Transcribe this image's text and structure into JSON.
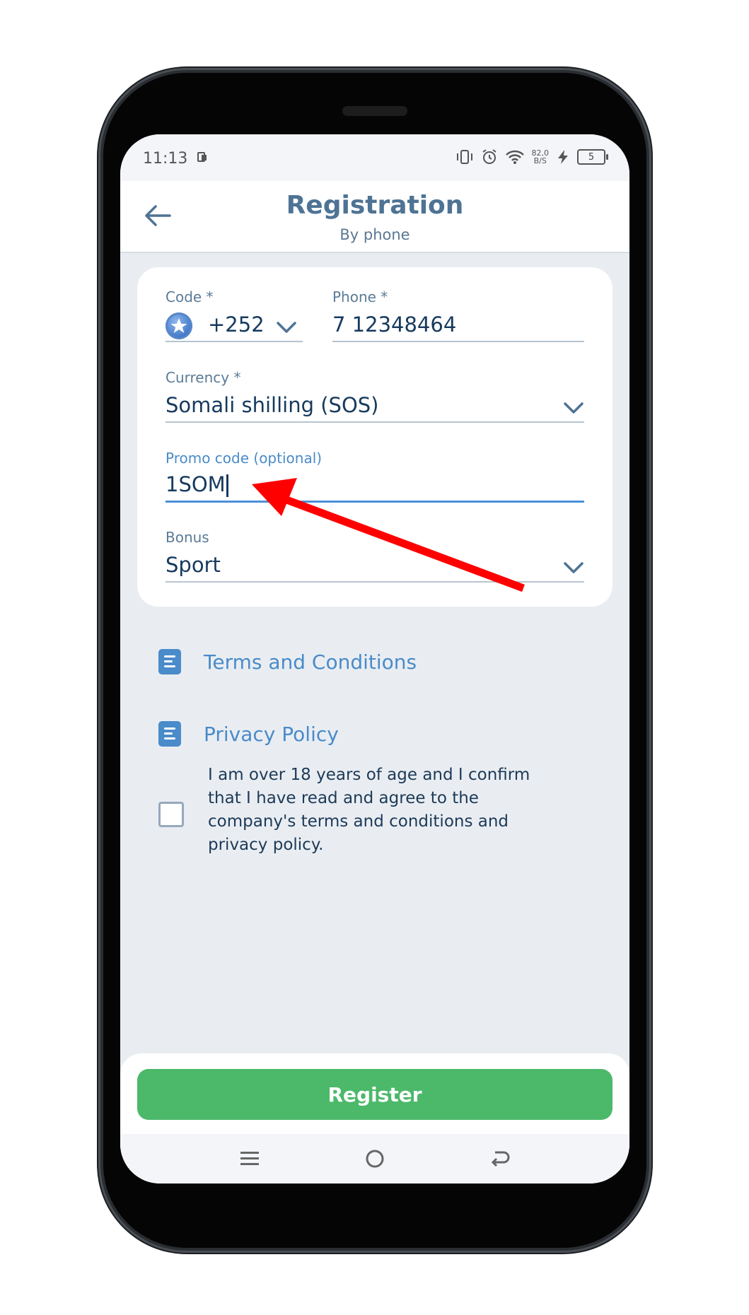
{
  "status_bar": {
    "time": "11:13",
    "net_speed_value": "82,0",
    "net_speed_unit": "B/S",
    "battery": "5",
    "icons": [
      "vibrate-icon",
      "alarm-icon",
      "wifi-icon",
      "charging-icon",
      "battery-icon"
    ]
  },
  "header": {
    "title": "Registration",
    "subtitle": "By phone",
    "back_icon": "arrow-left-icon"
  },
  "form": {
    "code_label": "Code *",
    "code_value": "+252",
    "phone_label": "Phone *",
    "phone_value": "7 12348464",
    "currency_label": "Currency *",
    "currency_value": "Somali shilling (SOS)",
    "promo_label": "Promo code (optional)",
    "promo_value": "1SOM",
    "bonus_label": "Bonus",
    "bonus_value": "Sport"
  },
  "links": {
    "terms": "Terms and Conditions",
    "privacy": "Privacy Policy"
  },
  "agreement": {
    "checked": false,
    "text": "I am over 18 years of age and I confirm that I have read and agree to the company's terms and conditions and privacy policy."
  },
  "actions": {
    "register": "Register"
  },
  "colors": {
    "accent_blue": "#4a8bc9",
    "register_green": "#4cb86a",
    "annotation_red": "#ff0000"
  }
}
